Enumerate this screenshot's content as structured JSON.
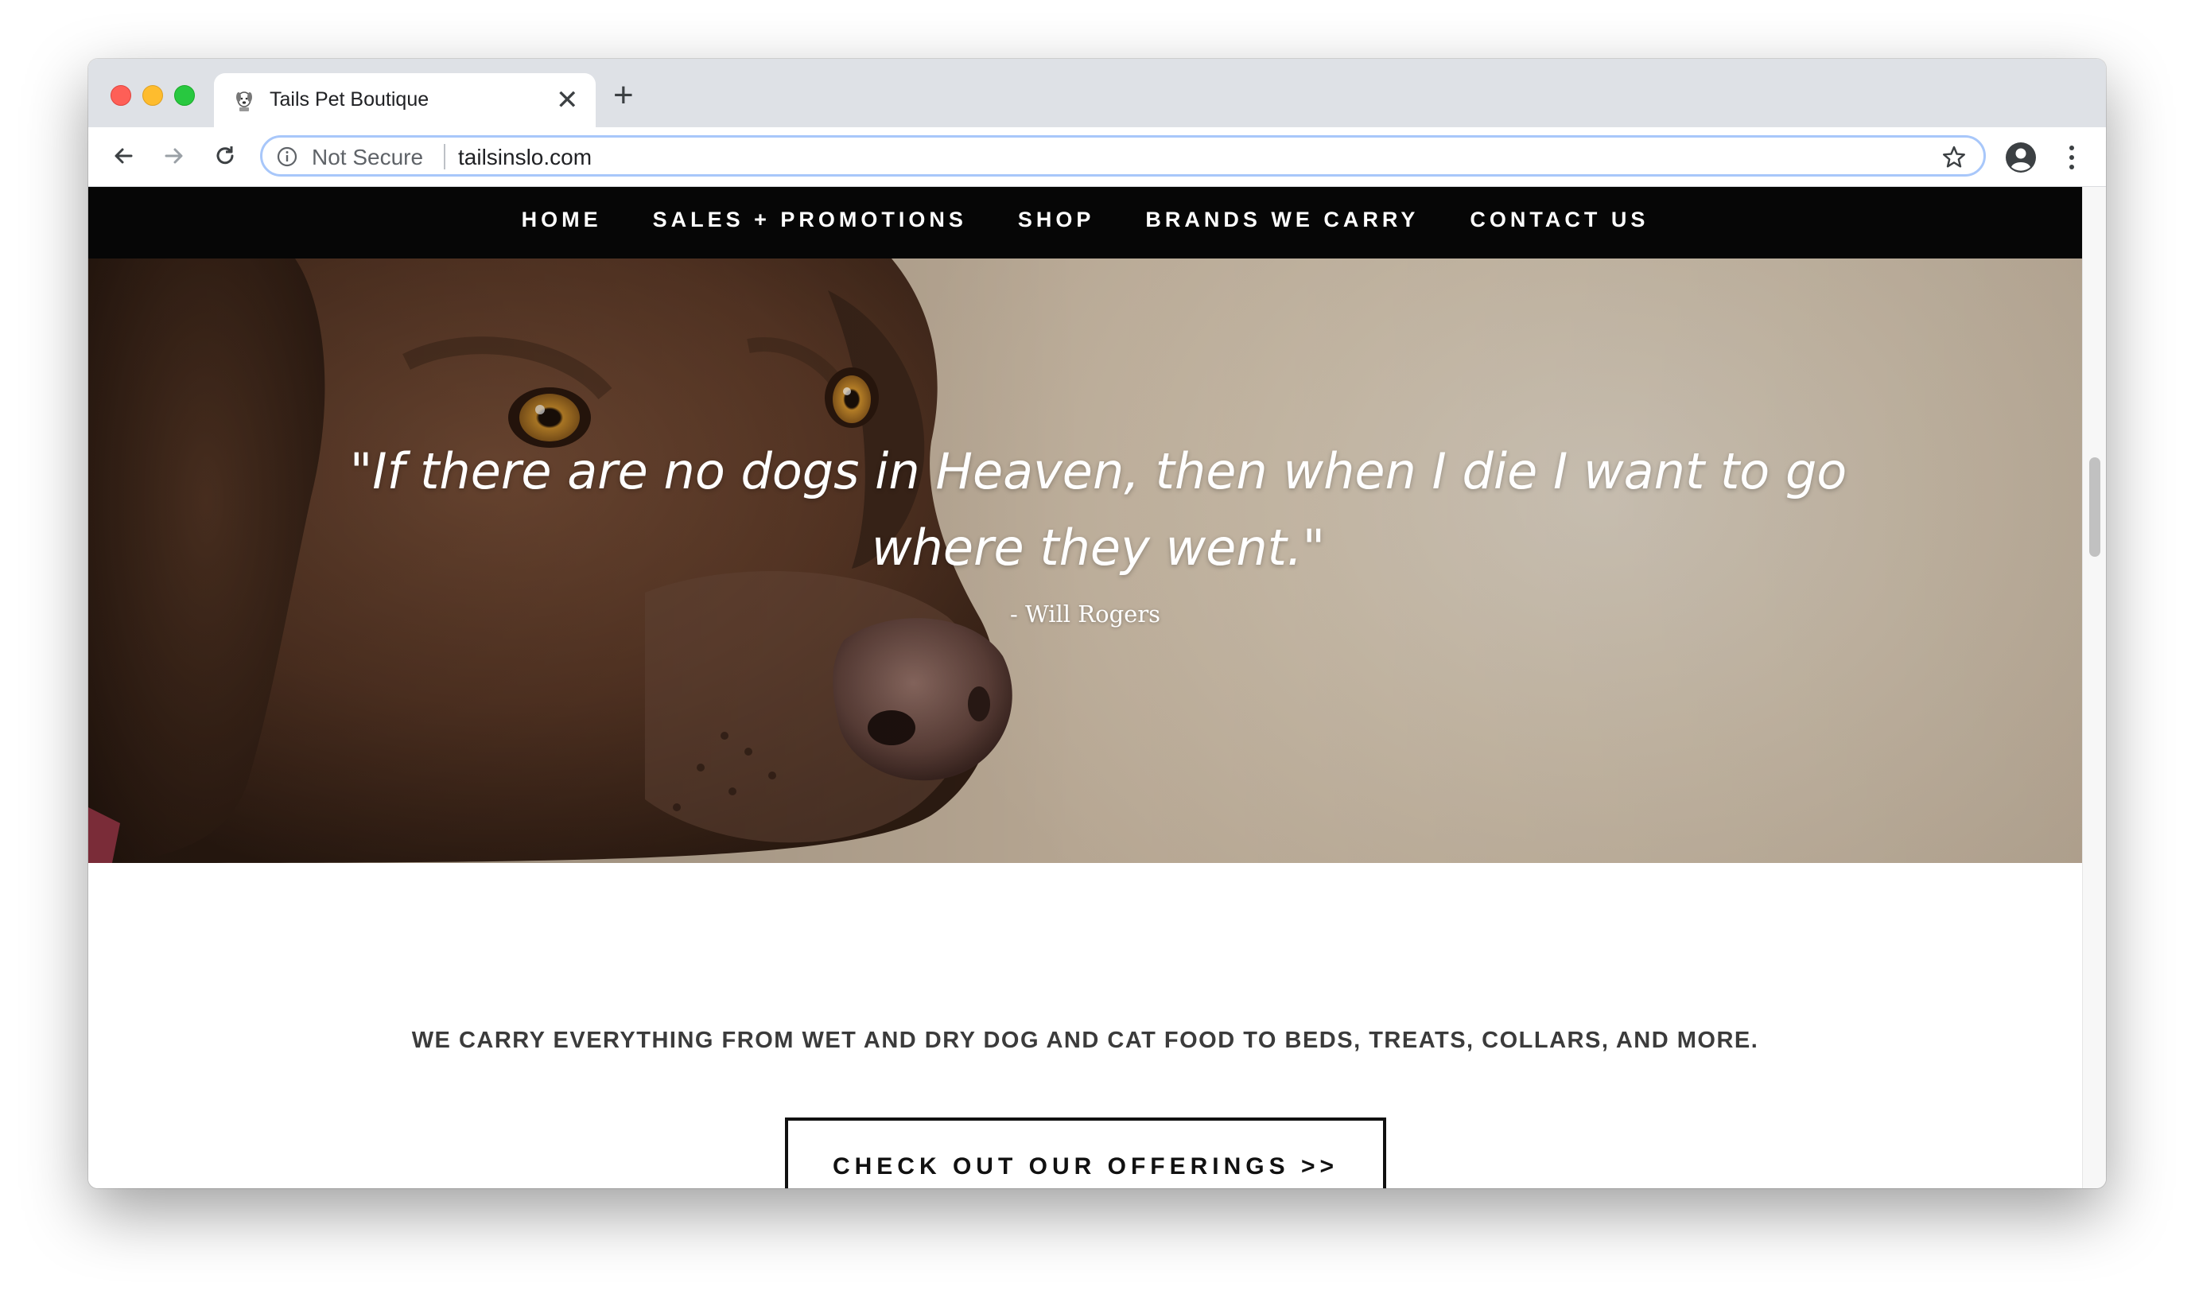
{
  "browser": {
    "tab_title": "Tails Pet Boutique",
    "tab_close": "✕",
    "new_tab": "+",
    "security_label": "Not Secure",
    "url": "tailsinslo.com",
    "icons": [
      "back-icon",
      "forward-icon",
      "reload-icon",
      "info-icon",
      "star-icon",
      "profile-icon",
      "menu-icon",
      "favicon-dog-icon"
    ]
  },
  "site": {
    "nav": [
      {
        "label": "HOME"
      },
      {
        "label": "SALES + PROMOTIONS"
      },
      {
        "label": "SHOP"
      },
      {
        "label": "BRANDS WE CARRY"
      },
      {
        "label": "CONTACT US"
      }
    ],
    "hero": {
      "quote": "\"If there are no dogs in Heaven, then when I die I want to go where they went.\"",
      "author": "- Will Rogers"
    },
    "tagline": "WE CARRY EVERYTHING FROM WET AND DRY DOG AND CAT FOOD TO BEDS, TREATS, COLLARS, AND MORE.",
    "cta_label": "CHECK OUT OUR OFFERINGS >>"
  },
  "colors": {
    "nav_background": "#060606",
    "omnibox_focus": "#a8c7fa",
    "tab_strip": "#dee1e6"
  }
}
